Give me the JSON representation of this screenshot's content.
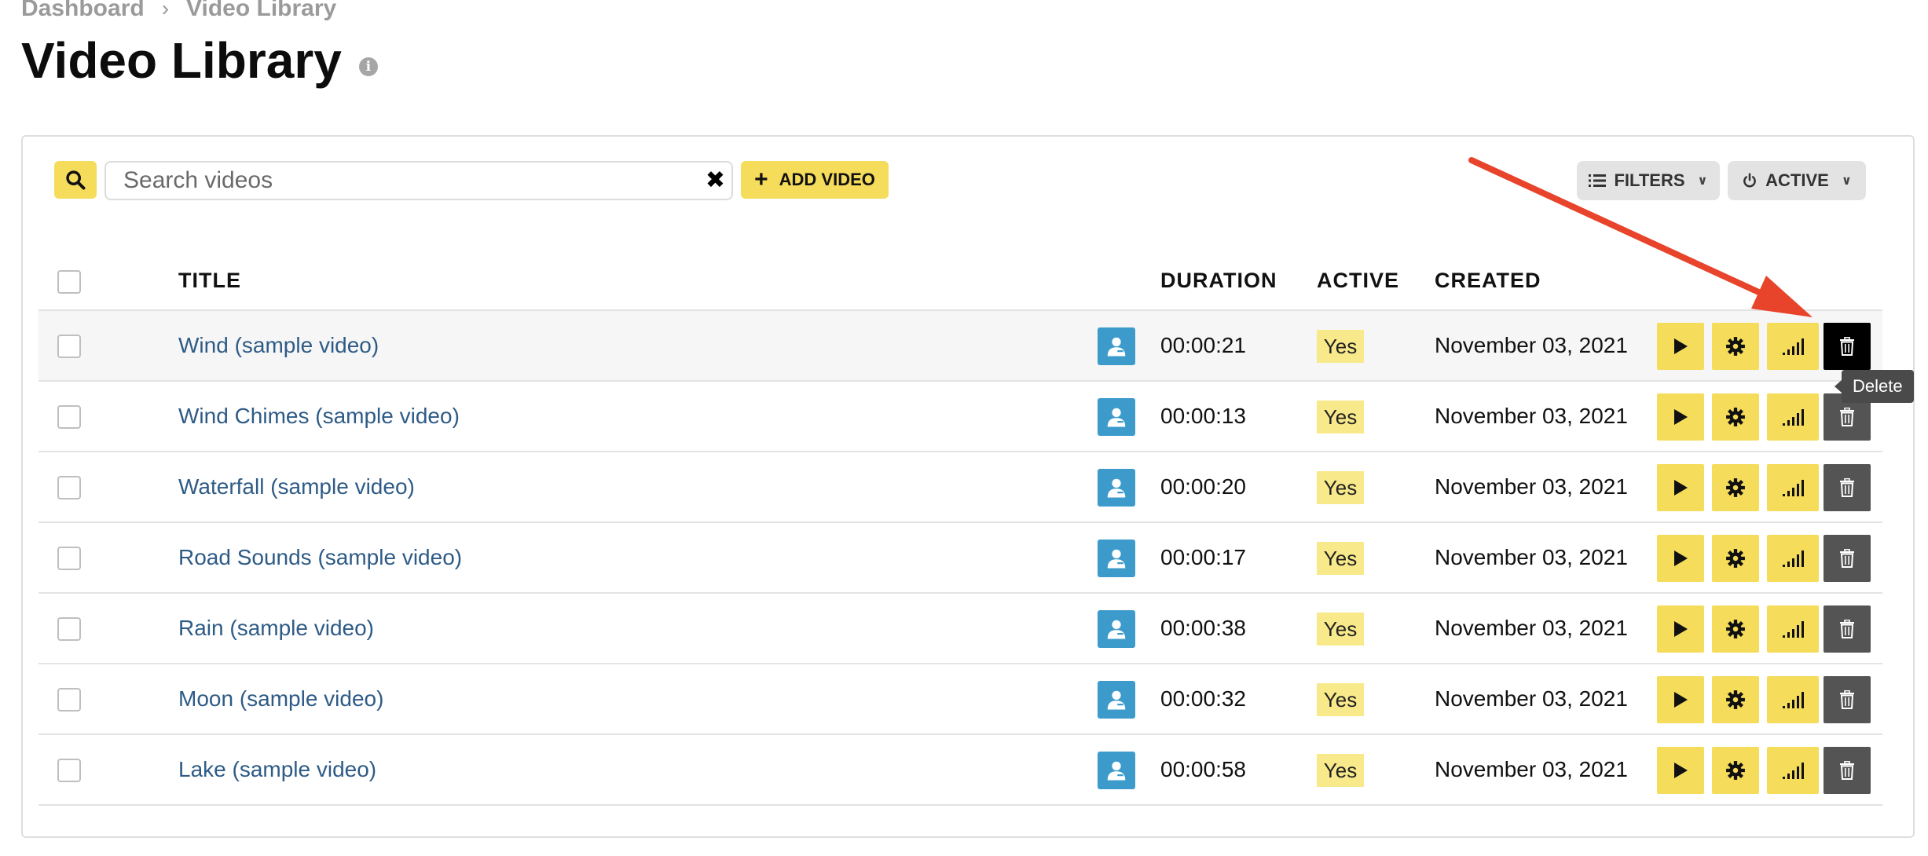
{
  "breadcrumb": {
    "root": "Dashboard",
    "current": "Video Library"
  },
  "page": {
    "title": "Video Library"
  },
  "toolbar": {
    "search_placeholder": "Search videos",
    "add_label": "ADD VIDEO",
    "filters_label": "FILTERS",
    "active_label": "ACTIVE"
  },
  "table": {
    "headers": {
      "title": "TITLE",
      "duration": "DURATION",
      "active": "ACTIVE",
      "created": "CREATED"
    },
    "rows": [
      {
        "title": "Wind (sample video)",
        "duration": "00:00:21",
        "active": "Yes",
        "created": "November 03, 2021"
      },
      {
        "title": "Wind Chimes (sample video)",
        "duration": "00:00:13",
        "active": "Yes",
        "created": "November 03, 2021"
      },
      {
        "title": "Waterfall (sample video)",
        "duration": "00:00:20",
        "active": "Yes",
        "created": "November 03, 2021"
      },
      {
        "title": "Road Sounds (sample video)",
        "duration": "00:00:17",
        "active": "Yes",
        "created": "November 03, 2021"
      },
      {
        "title": "Rain (sample video)",
        "duration": "00:00:38",
        "active": "Yes",
        "created": "November 03, 2021"
      },
      {
        "title": "Moon (sample video)",
        "duration": "00:00:32",
        "active": "Yes",
        "created": "November 03, 2021"
      },
      {
        "title": "Lake (sample video)",
        "duration": "00:00:58",
        "active": "Yes",
        "created": "November 03, 2021"
      }
    ]
  },
  "tooltip": {
    "text": "Delete"
  },
  "icons": {
    "search": "search-icon",
    "clear": "close-icon",
    "add": "plus-icon",
    "filters": "list-icon",
    "active": "power-icon",
    "owner": "user-icon",
    "play": "play-icon",
    "settings": "gear-icon",
    "stats": "signal-bars-icon",
    "delete": "trash-icon"
  },
  "colors": {
    "accent_yellow": "#f5dc5b",
    "badge_yellow": "#f8e98b",
    "link_blue": "#2e5b86",
    "owner_blue": "#3d9bcc",
    "delete_gray": "#545454",
    "annotation_arrow": "#e8432b"
  }
}
